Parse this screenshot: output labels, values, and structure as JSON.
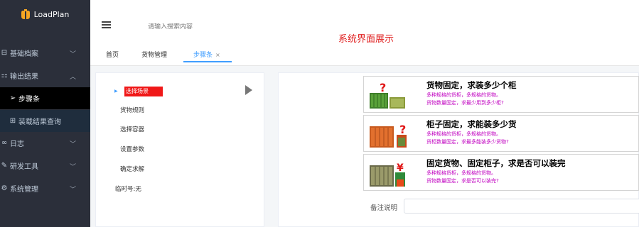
{
  "app": {
    "name": "LoadPlan"
  },
  "sidebar": {
    "items": [
      {
        "label": "基础档案",
        "icon": "archive-icon",
        "chevron": "﹀"
      },
      {
        "label": "输出结果",
        "icon": "output-icon",
        "chevron": "︿"
      },
      {
        "label": "步骤条",
        "icon": "send-icon",
        "chevron": ""
      },
      {
        "label": "装载结果查询",
        "icon": "table-icon",
        "chevron": ""
      },
      {
        "label": "日志",
        "icon": "log-icon",
        "chevron": "﹀"
      },
      {
        "label": "研发工具",
        "icon": "tool-icon",
        "chevron": "﹀"
      },
      {
        "label": "系统管理",
        "icon": "gear-icon",
        "chevron": "﹀"
      }
    ]
  },
  "header": {
    "search_placeholder": "请输入搜索内容",
    "system_title": "系统界面展示"
  },
  "tabs": [
    {
      "label": "首页"
    },
    {
      "label": "货物管理"
    },
    {
      "label": "步骤条",
      "close": "×"
    }
  ],
  "steps": {
    "items": [
      "选择场景",
      "货物规则",
      "选择容器",
      "设置参数",
      "确定求解"
    ],
    "temp_no": "临时号:无"
  },
  "scenarios": [
    {
      "title": "货物固定，求装多少个柜",
      "line1": "多种规格的货柜，多规格的货物。",
      "line2": "货物数量固定，求最少用到多少柜?"
    },
    {
      "title": "柜子固定，求能装多少货",
      "line1": "多种规格的货柜，多规格的货物。",
      "line2": "货柜数量固定，求最多能装多少货物?"
    },
    {
      "title": "固定货物、固定柜子，求是否可以装完",
      "line1": "多种规格货柜，多规格的货物。",
      "line2": "货物数量固定，求是否可以装完?"
    }
  ],
  "remark": {
    "label": "备注说明",
    "value": ""
  }
}
